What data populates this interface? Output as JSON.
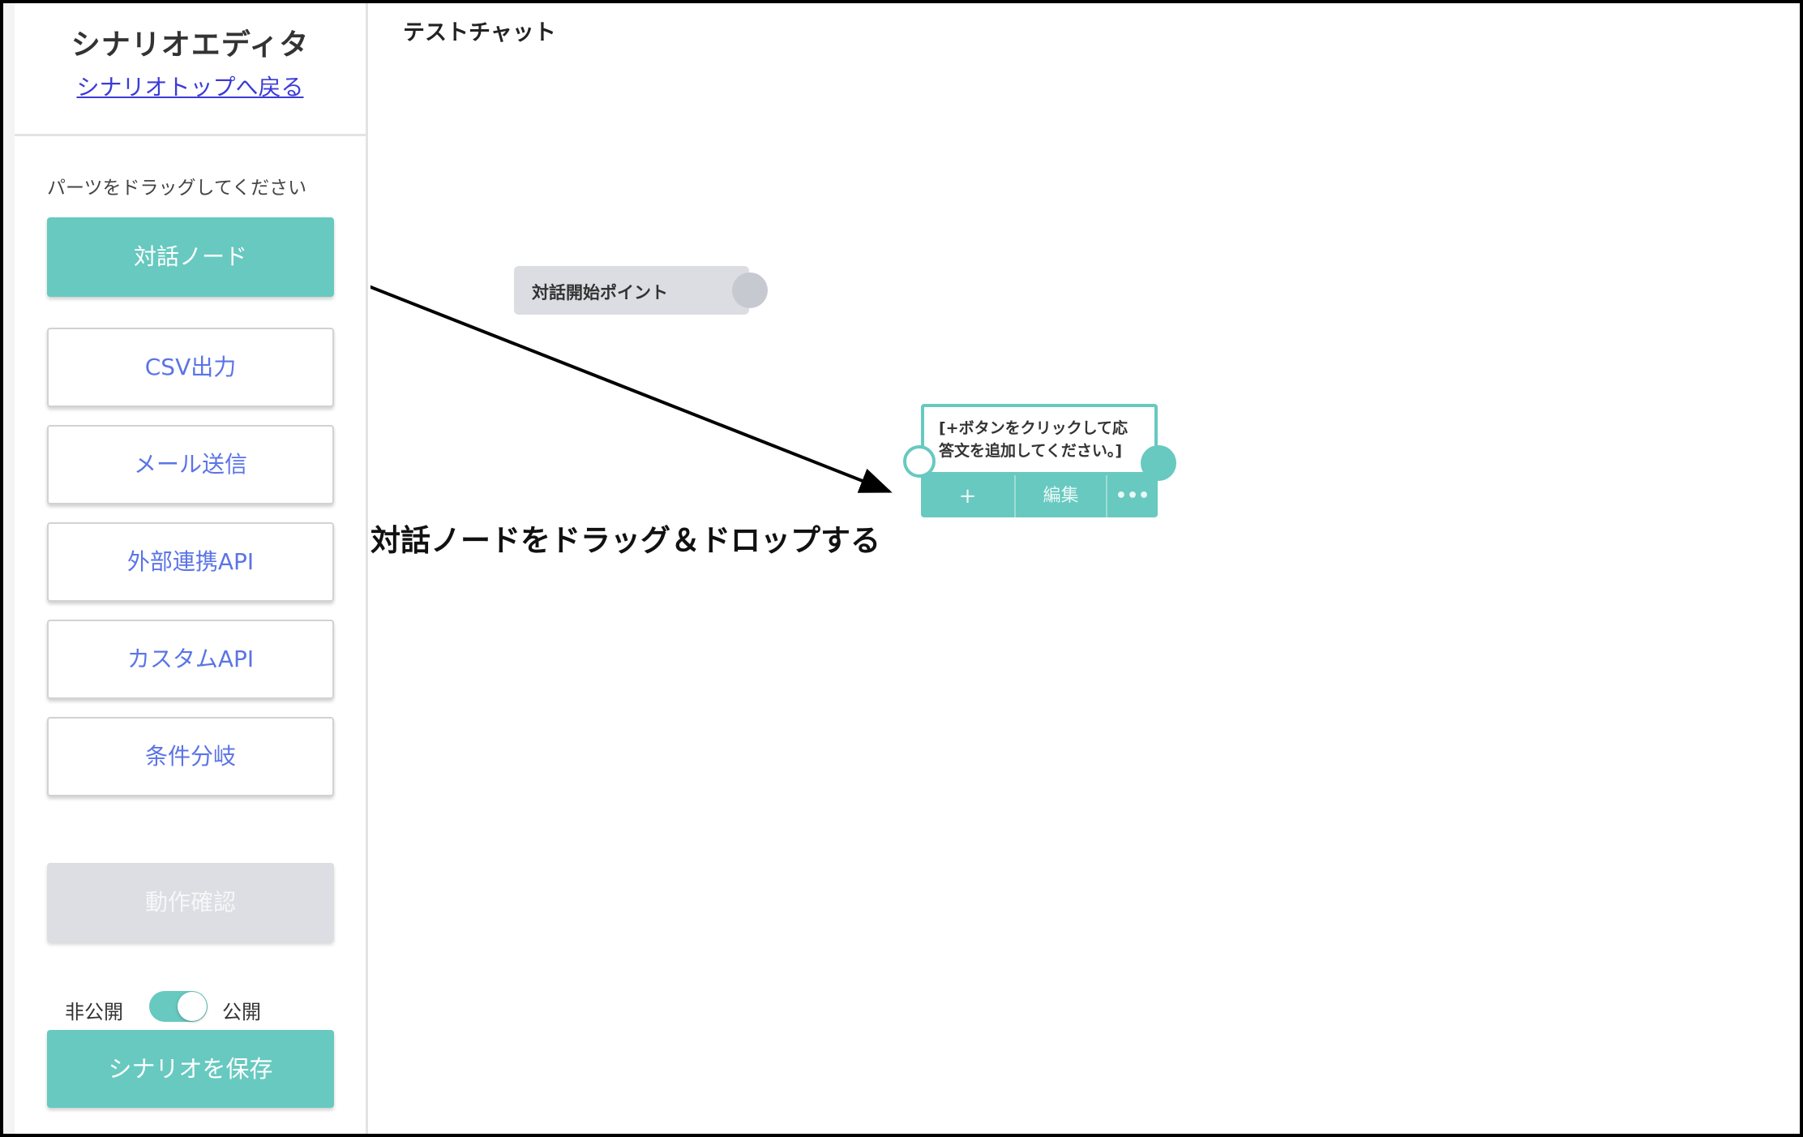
{
  "sidebar": {
    "title": "シナリオエディタ",
    "back_link": "シナリオトップへ戻る",
    "hint": "パーツをドラッグしてください",
    "parts": [
      {
        "label": "対話ノード",
        "primary": true
      },
      {
        "label": "CSV出力"
      },
      {
        "label": "メール送信"
      },
      {
        "label": "外部連携API"
      },
      {
        "label": "カスタムAPI"
      },
      {
        "label": "条件分岐"
      }
    ],
    "test_button": "動作確認",
    "toggle": {
      "off_label": "非公開",
      "on_label": "公開",
      "state": "on"
    },
    "save_button": "シナリオを保存"
  },
  "canvas": {
    "test_chat": "テストチャット",
    "start_point": "対話開始ポイント",
    "node": {
      "text_line1": "[+ボタンをクリックして応",
      "text_line2": "答文を追加してください。]",
      "add_label": "+",
      "edit_label": "編集",
      "more_label": "•••"
    },
    "instruction": "対話ノードをドラッグ＆ドロップする"
  },
  "colors": {
    "accent": "#67c9c0",
    "link": "#3b3bd8",
    "part_text": "#5b74e6",
    "disabled": "#dcdee3"
  },
  "icons": [
    "arrow-annotation",
    "toggle-switch",
    "ellipsis-icon",
    "plus-icon"
  ]
}
